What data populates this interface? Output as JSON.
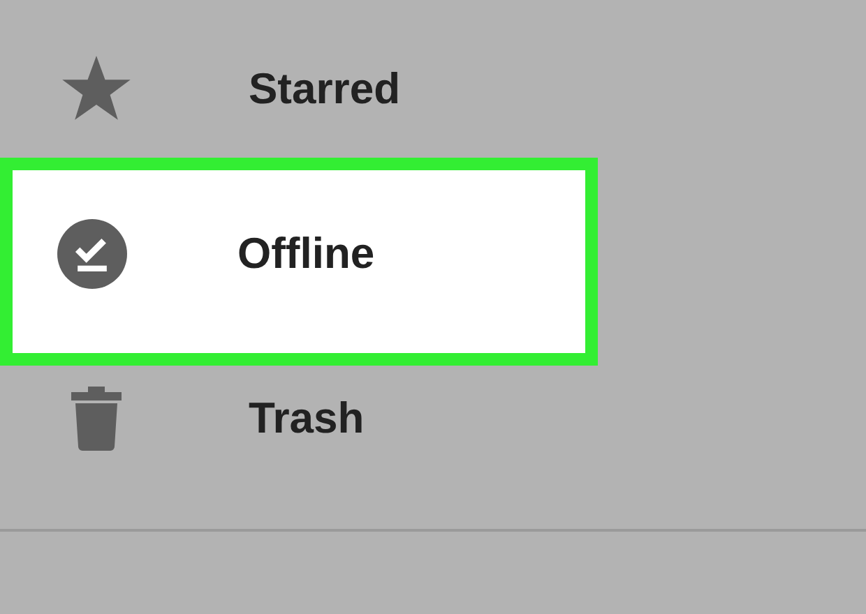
{
  "menu": {
    "items": [
      {
        "label": "Starred",
        "kind": "star",
        "selected": false
      },
      {
        "label": "Offline",
        "kind": "offline",
        "selected": true
      },
      {
        "label": "Trash",
        "kind": "trash",
        "selected": false
      }
    ]
  }
}
